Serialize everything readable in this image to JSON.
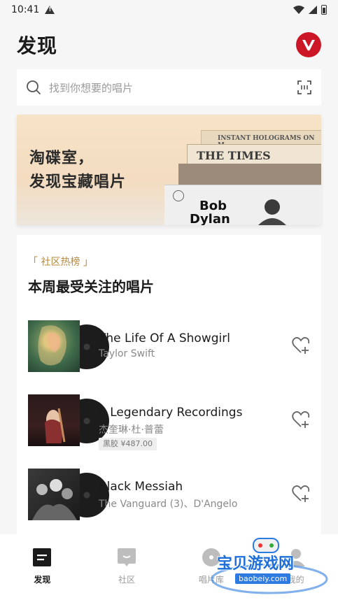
{
  "status_bar": {
    "time": "10:41"
  },
  "header": {
    "title": "发现"
  },
  "search": {
    "placeholder": "找到你想要的唱片"
  },
  "banner": {
    "text": "淘碟室，\n发现宝藏唱片",
    "record_labels": [
      "INSTANT HOLOGRAMS ON M",
      "THE TIMES",
      "Bob",
      "Dylan"
    ]
  },
  "chart_section": {
    "tag": "「 社区热榜 」",
    "title": "本周最受关注的唱片",
    "items": [
      {
        "title": "The Life Of A Showgirl",
        "artist": "Taylor Swift",
        "price": ""
      },
      {
        "title": "5 Legendary Recordings",
        "artist": "杰奎琳·杜·普蕾",
        "price": "黑胶 ¥487.00"
      },
      {
        "title": "Black Messiah",
        "artist": "The Vanguard (3)、D'Angelo",
        "price": ""
      }
    ]
  },
  "bottom_nav": {
    "items": [
      {
        "label": "发现",
        "icon": "discover-icon",
        "active": true
      },
      {
        "label": "社区",
        "icon": "community-icon",
        "active": false
      },
      {
        "label": "唱片库",
        "icon": "record-library-icon",
        "active": false
      },
      {
        "label": "我的",
        "icon": "profile-icon",
        "active": false
      }
    ]
  },
  "watermark": {
    "text": "宝贝游戏网",
    "url": "baobeiy.com"
  },
  "colors": {
    "accent": "#cc1626",
    "tag": "#b8893d",
    "watermark": "#1e6fd9"
  }
}
